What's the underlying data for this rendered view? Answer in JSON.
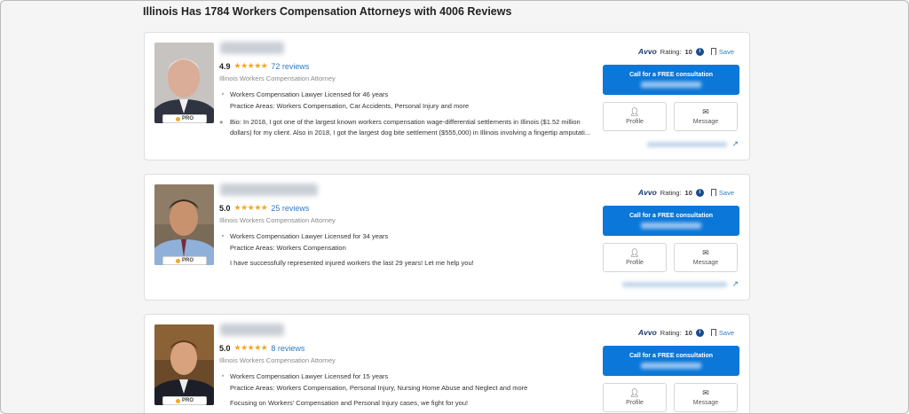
{
  "page_title": "Illinois Has 1784 Workers Compensation Attorneys with 4006 Reviews",
  "common": {
    "subtitle": "Illinois Workers Compensation Attorney",
    "avvo_logo": "Avvo",
    "rating_label": "Rating:",
    "save_label": "Save",
    "cta_label": "Call for a FREE consultation",
    "profile_label": "Profile",
    "message_label": "Message",
    "pro_label": "PRO",
    "info_glyph": "i"
  },
  "attorneys": [
    {
      "rating": "4.9",
      "stars": "★★★★★",
      "reviews": "72 reviews",
      "licensed": "Workers Compensation Lawyer Licensed for 46 years",
      "practice": "Practice Areas:  Workers Compensation,  Car Accidents, Personal Injury and more",
      "bio": "Bio: In 2018, I got one of the largest known workers compensation wage-differential settlements in Illinois ($1.52 million dollars) for my client. Also in 2018, I got the largest dog bite settlement ($555,000) in Illinois involving a fingertip amputati...",
      "avvo_rating": "10"
    },
    {
      "rating": "5.0",
      "stars": "★★★★★",
      "reviews": "25 reviews",
      "licensed": "Workers Compensation Lawyer Licensed for 34 years",
      "practice": "Practice Areas:  Workers Compensation",
      "bio": "I have successfully represented injured workers the last 29 years! Let me help you!",
      "avvo_rating": "10"
    },
    {
      "rating": "5.0",
      "stars": "★★★★★",
      "reviews": "8 reviews",
      "licensed": "Workers Compensation Lawyer Licensed for 15 years",
      "practice": "Practice Areas:  Workers Compensation, Personal Injury, Nursing Home Abuse and Neglect and more",
      "bio": "Focusing on Workers' Compensation and Personal Injury cases, we fight for you!",
      "avvo_rating": "10"
    }
  ],
  "colors": {
    "accent": "#0b77d8",
    "star": "#f5a623",
    "link": "#2f7cbf"
  }
}
